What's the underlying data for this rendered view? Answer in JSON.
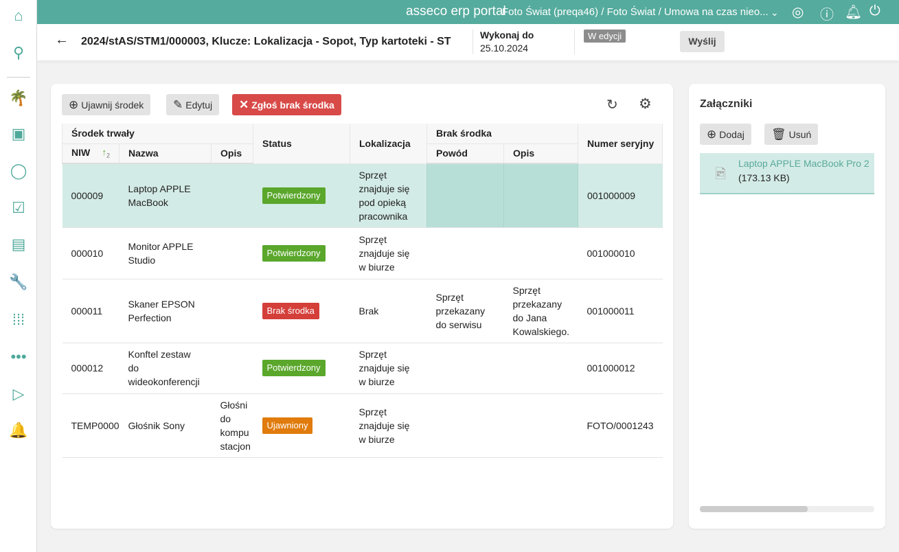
{
  "sidebar": {
    "items": [
      {
        "name": "home-icon",
        "glyph": "⌂"
      },
      {
        "name": "search-icon",
        "glyph": "⚲"
      },
      {
        "name": "palm-icon",
        "glyph": "🌴"
      },
      {
        "name": "wallet-icon",
        "glyph": "▣"
      },
      {
        "name": "user-icon",
        "glyph": "◯"
      },
      {
        "name": "tasks-icon",
        "glyph": "☑"
      },
      {
        "name": "inbox-icon",
        "glyph": "▤"
      },
      {
        "name": "wrench-icon",
        "glyph": "🔧"
      },
      {
        "name": "apps-icon",
        "glyph": "⁞⁞⁞"
      },
      {
        "name": "more-icon",
        "glyph": "•••"
      },
      {
        "name": "presentation-icon",
        "glyph": "▷"
      },
      {
        "name": "bell-icon",
        "glyph": "🔔"
      }
    ]
  },
  "topbar": {
    "brand": "asseco erp portal",
    "context": "Foto Świat (preqa46) / Foto Świat / Umowa na czas nieo..."
  },
  "header": {
    "title": "2024/stAS/STM1/000003, Klucze: Lokalizacja - Sopot, Typ kartoteki - ST",
    "due_label": "Wykonaj do",
    "due_value": "25.10.2024",
    "status": "W edycji",
    "send": "Wyślij"
  },
  "toolbar": {
    "reveal": "Ujawnij środek",
    "edit": "Edytuj",
    "report_missing": "Zgłoś brak środka"
  },
  "table": {
    "group_asset": "Środek trwały",
    "group_missing": "Brak środka",
    "columns": {
      "niw": "NIW",
      "sort_index": "2",
      "name": "Nazwa",
      "desc": "Opis",
      "status": "Status",
      "location": "Lokalizacja",
      "reason": "Powód",
      "missing_desc": "Opis",
      "serial": "Numer seryjny"
    },
    "rows": [
      {
        "niw": "000009",
        "name": "Laptop APPLE MacBook",
        "desc": "",
        "status": "Potwierdzony",
        "status_color": "#5aa72c",
        "location": "Sprzęt znajduje się pod opieką pracownika",
        "reason": "",
        "missing_desc": "",
        "serial": "001000009"
      },
      {
        "niw": "000010",
        "name": "Monitor APPLE Studio",
        "desc": "",
        "status": "Potwierdzony",
        "status_color": "#5aa72c",
        "location": "Sprzęt znajduje się w biurze",
        "reason": "",
        "missing_desc": "",
        "serial": "001000010"
      },
      {
        "niw": "000011",
        "name": "Skaner EPSON Perfection",
        "desc": "",
        "status": "Brak środka",
        "status_color": "#d43f3a",
        "location": "Brak",
        "reason": "Sprzęt przekazany do serwisu",
        "missing_desc": "Sprzęt przekazany do Jana Kowalskiego.",
        "serial": "001000011"
      },
      {
        "niw": "000012",
        "name": "Konftel zestaw do wideokonferencji",
        "desc": "",
        "status": "Potwierdzony",
        "status_color": "#5aa72c",
        "location": "Sprzęt znajduje się w biurze",
        "reason": "",
        "missing_desc": "",
        "serial": "001000012"
      },
      {
        "niw": "TEMP0000",
        "name": "Głośnik Sony",
        "desc": "Głośni do kompu stacjon",
        "status": "Ujawniony",
        "status_color": "#e07b0c",
        "location": "Sprzęt znajduje się w biurze",
        "reason": "",
        "missing_desc": "",
        "serial": "FOTO/0001243"
      }
    ]
  },
  "attachments": {
    "title": "Załączniki",
    "add": "Dodaj",
    "delete": "Usuń",
    "file_name": "Laptop APPLE MacBook Pro 2",
    "file_size": "(173.13 KB)"
  }
}
